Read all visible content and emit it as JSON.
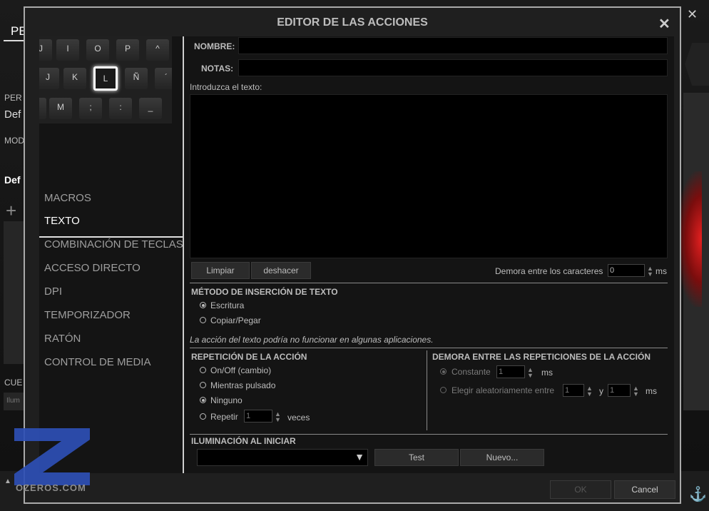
{
  "background": {
    "tab_label": "PE",
    "labels": [
      "PER",
      "Def",
      "MOD",
      "Def",
      "CUE",
      "Ilum"
    ],
    "plus": "+",
    "close": "✕",
    "arrow": "▲"
  },
  "logo": {
    "text": "OZEROS.COM"
  },
  "dialog": {
    "title": "EDITOR DE LAS ACCIONES",
    "close": "✕",
    "keyboard": {
      "row1": [
        "J",
        "I",
        "O",
        "P",
        "^"
      ],
      "row2": [
        "J",
        "K",
        "L",
        "Ñ",
        "´"
      ],
      "row3": [
        "",
        "M",
        ";",
        ":",
        "_"
      ]
    },
    "sidebar": [
      "MACROS",
      "TEXTO",
      "COMBINACIÓN DE TECLAS",
      "ACCESO DIRECTO",
      "DPI",
      "TEMPORIZADOR",
      "RATÓN",
      "CONTROL DE MEDIA"
    ],
    "form": {
      "name_label": "NOMBRE:",
      "name_value": "",
      "notes_label": "NOTAS:",
      "notes_value": "",
      "text_label": "Introduzca el texto:",
      "text_value": "",
      "clear_button": "Limpiar",
      "undo_button": "deshacer",
      "char_delay_label": "Demora entre los caracteres",
      "char_delay_value": "0",
      "char_delay_unit": "ms"
    },
    "insertion": {
      "title": "MÉTODO DE INSERCIÓN DE TEXTO",
      "options": [
        "Escritura",
        "Copiar/Pegar"
      ],
      "selected": "Escritura",
      "note": "La acción del texto podría no funcionar en algunas aplicaciones."
    },
    "repetition": {
      "title": "REPETICIÓN DE LA ACCIÓN",
      "options": [
        "On/Off (cambio)",
        "Mientras pulsado",
        "Ninguno",
        "Repetir"
      ],
      "selected": "Ninguno",
      "repeat_value": "1",
      "repeat_unit": "veces"
    },
    "delay": {
      "title": "DEMORA ENTRE LAS REPETICIONES DE LA ACCIÓN",
      "constant_label": "Constante",
      "constant_value": "1",
      "constant_unit": "ms",
      "random_label": "Elegir aleatoriamente entre",
      "random_min": "1",
      "random_and": "y",
      "random_max": "1",
      "random_unit": "ms"
    },
    "lighting": {
      "title": "ILUMINACIÓN AL INICIAR",
      "selected": "",
      "test_button": "Test",
      "new_button": "Nuevo..."
    },
    "footer": {
      "ok_button": "OK",
      "cancel_button": "Cancel"
    }
  },
  "colors": {
    "accent_red": "#e52020",
    "dialog_bg": "#1f1f1f",
    "field_bg": "#000000"
  }
}
